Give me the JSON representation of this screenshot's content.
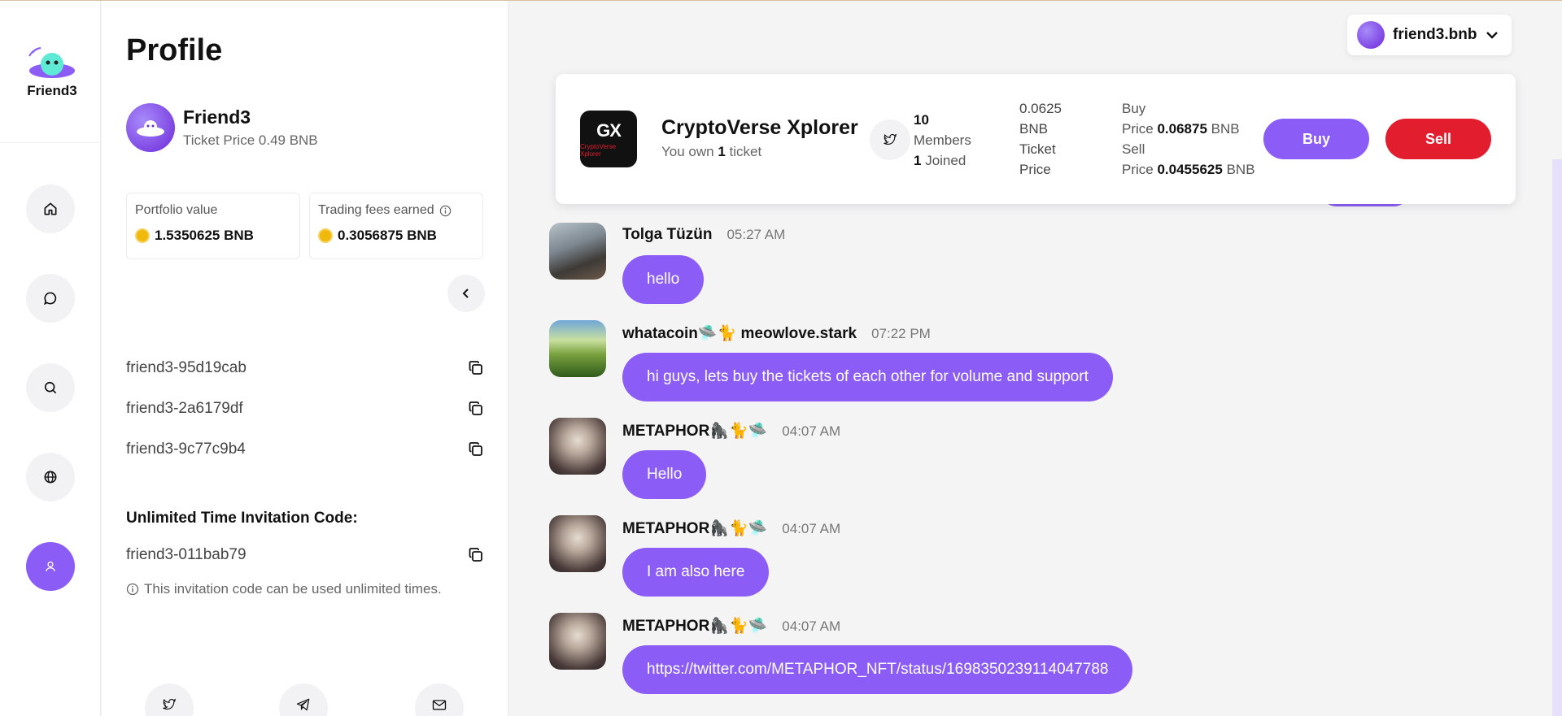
{
  "app": {
    "logo_text": "Friend3",
    "account_name": "friend3.bnb"
  },
  "profile": {
    "title": "Profile",
    "name": "Friend3",
    "ticket_price": "Ticket Price 0.49 BNB",
    "portfolio_label": "Portfolio value",
    "portfolio_value": "1.5350625 BNB",
    "fees_label": "Trading fees earned",
    "fees_value": "0.3056875 BNB",
    "codes": [
      "friend3-95d19cab",
      "friend3-2a6179df",
      "friend3-9c77c9b4"
    ],
    "invitation_title": "Unlimited Time Invitation Code:",
    "invitation_code": "friend3-011bab79",
    "invitation_note": "This invitation code can be used unlimited times."
  },
  "nav": [
    "home-icon",
    "chat-icon",
    "search-icon",
    "globe-icon",
    "profile-icon"
  ],
  "social": [
    "twitter-icon",
    "telegram-icon",
    "mail-icon"
  ],
  "room": {
    "logo_big": "GX",
    "logo_small": "CryptoVerse Xplorer",
    "name": "CryptoVerse Xplorer",
    "own_prefix": "You own",
    "own_count": "1",
    "own_suffix": "ticket",
    "members_count": "10",
    "members_label": "Members",
    "joined_count": "1",
    "joined_label": "Joined",
    "ticket_price_line1": "0.0625",
    "ticket_price_line2": "BNB",
    "ticket_price_line3": "Ticket",
    "ticket_price_line4": "Price",
    "buy_line1": "Buy",
    "buy_price_label": "Price",
    "buy_price_value": "0.06875",
    "buy_unit": "BNB",
    "sell_line1": "Sell",
    "sell_price_label": "Price",
    "sell_price_value": "0.0455625",
    "sell_unit": "BNB",
    "buy_button": "Buy",
    "sell_button": "Sell"
  },
  "messages": [
    {
      "user": "Tolga Tüzün",
      "time": "05:27 AM",
      "text": "hello"
    },
    {
      "user": "whatacoin🛸🐈 meowlove.stark",
      "time": "07:22 PM",
      "text": "hi guys, lets buy the tickets of each other for volume and support"
    },
    {
      "user": "METAPHOR🦍🐈🛸",
      "time": "04:07 AM",
      "text": "Hello"
    },
    {
      "user": "METAPHOR🦍🐈🛸",
      "time": "04:07 AM",
      "text": "I am also here"
    },
    {
      "user": "METAPHOR🦍🐈🛸",
      "time": "04:07 AM",
      "text": "https://twitter.com/METAPHOR_NFT/status/1698350239114047788"
    }
  ],
  "colors": {
    "accent": "#8b5cf6",
    "sell": "#e11d2e",
    "coin": "#f0b90b"
  }
}
